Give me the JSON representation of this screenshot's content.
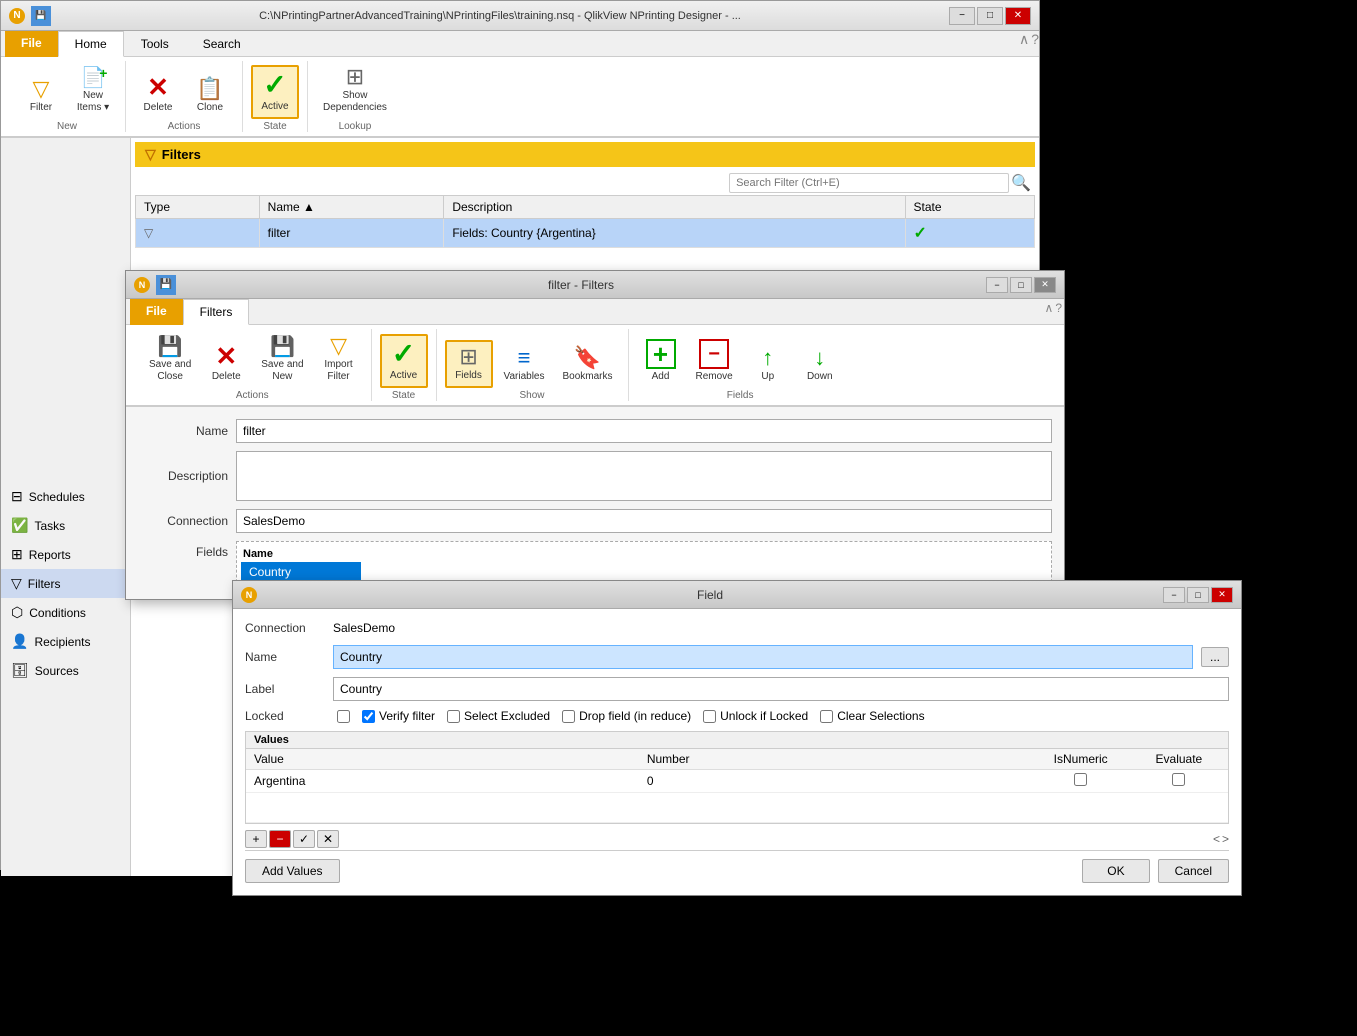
{
  "mainWindow": {
    "titleText": "C:\\NPrintingPartnerAdvancedTraining\\NPrintingFiles\\training.nsq - QlikView NPrinting Designer - ...",
    "tabs": [
      "File",
      "Home",
      "Tools",
      "Search"
    ],
    "activeTab": "Home",
    "ribbonGroups": [
      {
        "label": "New",
        "buttons": [
          {
            "id": "filter-btn",
            "icon": "▽",
            "label": "Filter",
            "iconColor": "orange"
          },
          {
            "id": "new-items-btn",
            "icon": "📄",
            "label": "New\nItems",
            "iconColor": "green",
            "hasDropdown": true
          }
        ]
      },
      {
        "label": "Actions",
        "buttons": [
          {
            "id": "delete-btn",
            "icon": "✕",
            "label": "Delete",
            "iconColor": "red"
          },
          {
            "id": "clone-btn",
            "icon": "📋",
            "label": "Clone",
            "iconColor": "blue"
          }
        ]
      },
      {
        "label": "State",
        "buttons": [
          {
            "id": "active-btn",
            "icon": "✓",
            "label": "Active",
            "iconColor": "green",
            "isActive": true
          }
        ]
      },
      {
        "label": "Lookup",
        "buttons": [
          {
            "id": "show-deps-btn",
            "icon": "⊞",
            "label": "Show\nDependencies",
            "iconColor": "gray"
          }
        ]
      }
    ]
  },
  "filterBar": {
    "label": "Filters",
    "icon": "funnel"
  },
  "searchBox": {
    "placeholder": "Search Filter (Ctrl+E)"
  },
  "table": {
    "columns": [
      "Type",
      "Name",
      "Description",
      "State"
    ],
    "rows": [
      {
        "type": "funnel",
        "name": "filter",
        "description": "Fields: Country {Argentina}",
        "state": "✓"
      }
    ]
  },
  "sidebar": {
    "items": [
      {
        "id": "schedules",
        "label": "Schedules",
        "icon": "⊟"
      },
      {
        "id": "tasks",
        "label": "Tasks",
        "icon": "✅"
      },
      {
        "id": "reports",
        "label": "Reports",
        "icon": "⊞"
      },
      {
        "id": "filters",
        "label": "Filters",
        "icon": "▽",
        "active": true
      },
      {
        "id": "conditions",
        "label": "Conditions",
        "icon": "⬡"
      },
      {
        "id": "recipients",
        "label": "Recipients",
        "icon": "👤"
      },
      {
        "id": "sources",
        "label": "Sources",
        "icon": "🗄"
      }
    ]
  },
  "filterDialog": {
    "title": "filter - Filters",
    "tabs": [
      "File",
      "Filters"
    ],
    "activeTab": "Filters",
    "ribbonGroups": [
      {
        "label": "Actions",
        "buttons": [
          {
            "id": "save-close-btn",
            "icon": "💾",
            "label": "Save and\nClose",
            "iconColor": "blue"
          },
          {
            "id": "delete-btn2",
            "icon": "✕",
            "label": "Delete",
            "iconColor": "red"
          },
          {
            "id": "save-new-btn",
            "icon": "💾",
            "label": "Save and\nNew",
            "iconColor": "blue"
          },
          {
            "id": "import-filter-btn",
            "icon": "▽",
            "label": "Import\nFilter",
            "iconColor": "gray"
          }
        ]
      },
      {
        "label": "State",
        "buttons": [
          {
            "id": "active-btn2",
            "icon": "✓",
            "label": "Active",
            "iconColor": "green",
            "isActive": true
          }
        ]
      },
      {
        "label": "Show",
        "buttons": [
          {
            "id": "fields-btn",
            "icon": "⊞",
            "label": "Fields",
            "iconColor": "gray",
            "isActive": true
          },
          {
            "id": "variables-btn",
            "icon": "≡",
            "label": "Variables",
            "iconColor": "blue"
          },
          {
            "id": "bookmarks-btn",
            "icon": "🔖",
            "label": "Bookmarks",
            "iconColor": "red"
          }
        ]
      },
      {
        "label": "Fields",
        "buttons": [
          {
            "id": "add-btn",
            "icon": "+",
            "label": "Add",
            "iconColor": "green"
          },
          {
            "id": "remove-btn",
            "icon": "−",
            "label": "Remove",
            "iconColor": "red"
          },
          {
            "id": "up-btn",
            "icon": "↑",
            "label": "Up",
            "iconColor": "green"
          },
          {
            "id": "down-btn",
            "icon": "↓",
            "label": "Down",
            "iconColor": "green"
          }
        ]
      }
    ],
    "form": {
      "nameLabel": "Name",
      "nameValue": "filter",
      "descriptionLabel": "Description",
      "descriptionValue": "",
      "connectionLabel": "Connection",
      "connectionValue": "SalesDemo",
      "fieldsLabel": "Fields"
    },
    "fieldsList": [
      "Country"
    ]
  },
  "fieldDialog": {
    "title": "Field",
    "connectionLabel": "Connection",
    "connectionValue": "SalesDemo",
    "nameLabel": "Name",
    "nameValue": "Country",
    "labelLabel": "Label",
    "labelValue": "Country",
    "lockedLabel": "Locked",
    "checkboxes": [
      {
        "id": "locked",
        "label": "",
        "checked": false
      },
      {
        "id": "verify-filter",
        "label": "Verify filter",
        "checked": true
      },
      {
        "id": "select-excluded",
        "label": "Select Excluded",
        "checked": false
      },
      {
        "id": "drop-field",
        "label": "Drop field (in reduce)",
        "checked": false
      },
      {
        "id": "unlock-locked",
        "label": "Unlock if Locked",
        "checked": false
      },
      {
        "id": "clear-selections",
        "label": "Clear Selections",
        "checked": false
      }
    ],
    "valuesSection": {
      "label": "Values",
      "columns": [
        "Value",
        "Number",
        "",
        "IsNumeric",
        "Evaluate"
      ],
      "rows": [
        {
          "value": "Argentina",
          "number": "0",
          "isNumeric": false,
          "evaluate": false
        }
      ]
    },
    "toolbarButtons": [
      "+",
      "−",
      "✓",
      "✕"
    ],
    "bottomButtons": [
      "Add Values",
      "OK",
      "Cancel"
    ]
  }
}
